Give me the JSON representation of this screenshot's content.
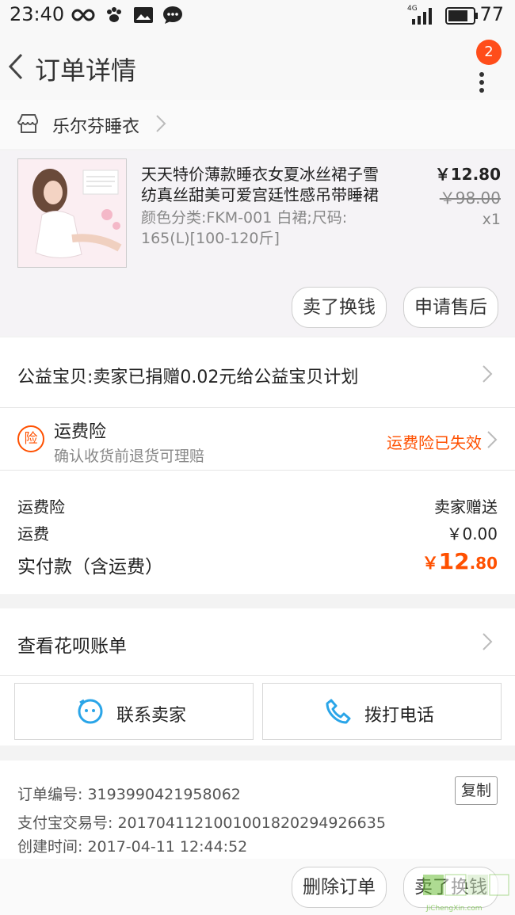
{
  "status_bar": {
    "time": "23:40",
    "network": "4G",
    "battery": "77"
  },
  "header": {
    "title": "订单详情",
    "badge": "2"
  },
  "shop": {
    "name": "乐尔芬睡衣"
  },
  "item": {
    "title": "天天特价薄款睡衣女夏冰丝裙子雪纺真丝甜美可爱宫廷性感吊带睡裙",
    "title_line1": "天天特价薄款睡衣女夏冰丝裙子雪",
    "title_line2": "纺真丝甜美可爱宫廷性感吊带睡裙",
    "sku_line1": "颜色分类:FKM-001 白裙;尺码:",
    "sku_line2": "165(L)[100-120斤]",
    "price": "￥12.80",
    "original_price": "￥98.00",
    "quantity": "x1",
    "btn_resell": "卖了换钱",
    "btn_aftersale": "申请售后"
  },
  "charity": {
    "text": "公益宝贝:卖家已捐赠0.02元给公益宝贝计划"
  },
  "insurance": {
    "badge": "险",
    "title": "运费险",
    "subtitle": "确认收货前退货可理赔",
    "status": "运费险已失效"
  },
  "costs": {
    "insurance_label": "运费险",
    "insurance_value": "卖家赠送",
    "shipping_label": "运费",
    "shipping_value": "￥0.00",
    "total_label": "实付款（含运费）",
    "total_currency": "￥",
    "total_int": "12",
    "total_dec": ".80"
  },
  "huabei": {
    "label": "查看花呗账单"
  },
  "contact": {
    "contact_seller": "联系卖家",
    "call_phone": "拨打电话"
  },
  "order_info": {
    "order_no_label": "订单编号:",
    "order_no": "3193990421958062",
    "copy": "复制",
    "alipay_label": "支付宝交易号:",
    "alipay_no": "2017041121001001820294926635",
    "created_label": "创建时间:",
    "created_time": "2017-04-11 12:44:52"
  },
  "footer": {
    "delete_order": "删除订单",
    "resell": "卖了换钱",
    "watermark": "JiChengXin.com"
  },
  "colors": {
    "accent": "#ff5000",
    "blue": "#2aa5e8",
    "badge": "#ff4d1a"
  }
}
